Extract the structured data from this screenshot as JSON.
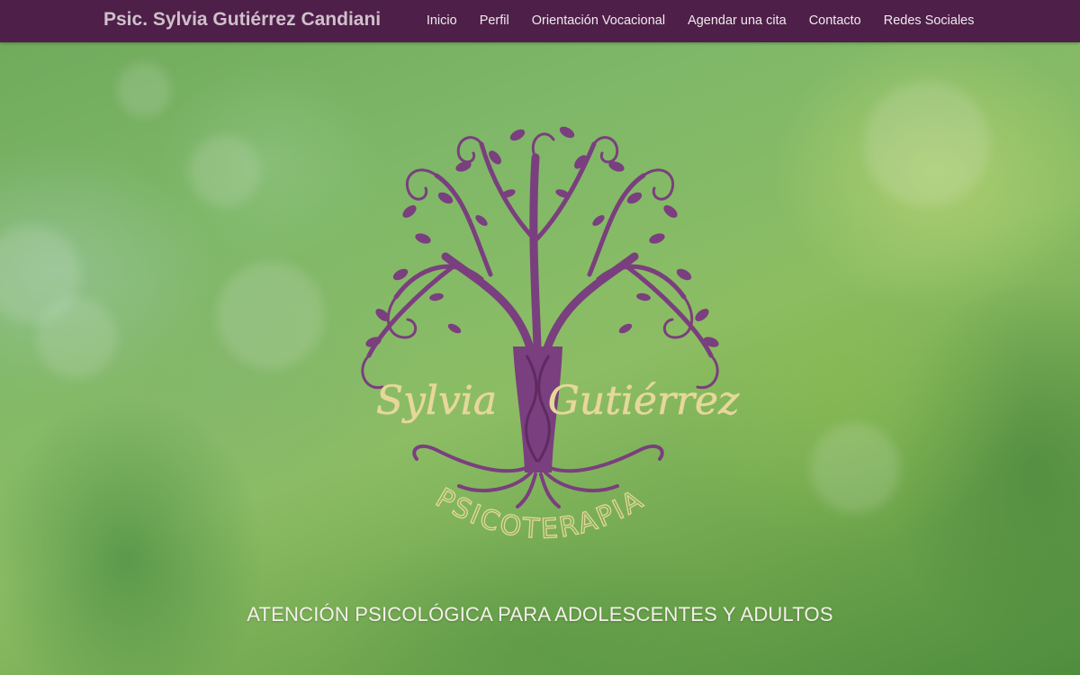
{
  "header": {
    "brand": "Psic. Sylvia Gutiérrez Candiani",
    "nav": [
      {
        "label": "Inicio"
      },
      {
        "label": "Perfil"
      },
      {
        "label": "Orientación Vocacional"
      },
      {
        "label": "Agendar una cita"
      },
      {
        "label": "Contacto"
      },
      {
        "label": "Redes Sociales"
      }
    ]
  },
  "hero": {
    "logo": {
      "name_first": "Sylvia",
      "name_last": "Gutiérrez",
      "subtitle": "PSICOTERAPIA",
      "icon": "tree-of-life-icon"
    },
    "tagline": "ATENCIÓN PSICOLÓGICA PARA ADOLESCENTES Y ADULTOS"
  },
  "colors": {
    "header_bg": "#4e1f48",
    "tree_purple": "#7a3f7e",
    "logo_gold": "#e6d79a",
    "background_green": "#7fb868"
  }
}
